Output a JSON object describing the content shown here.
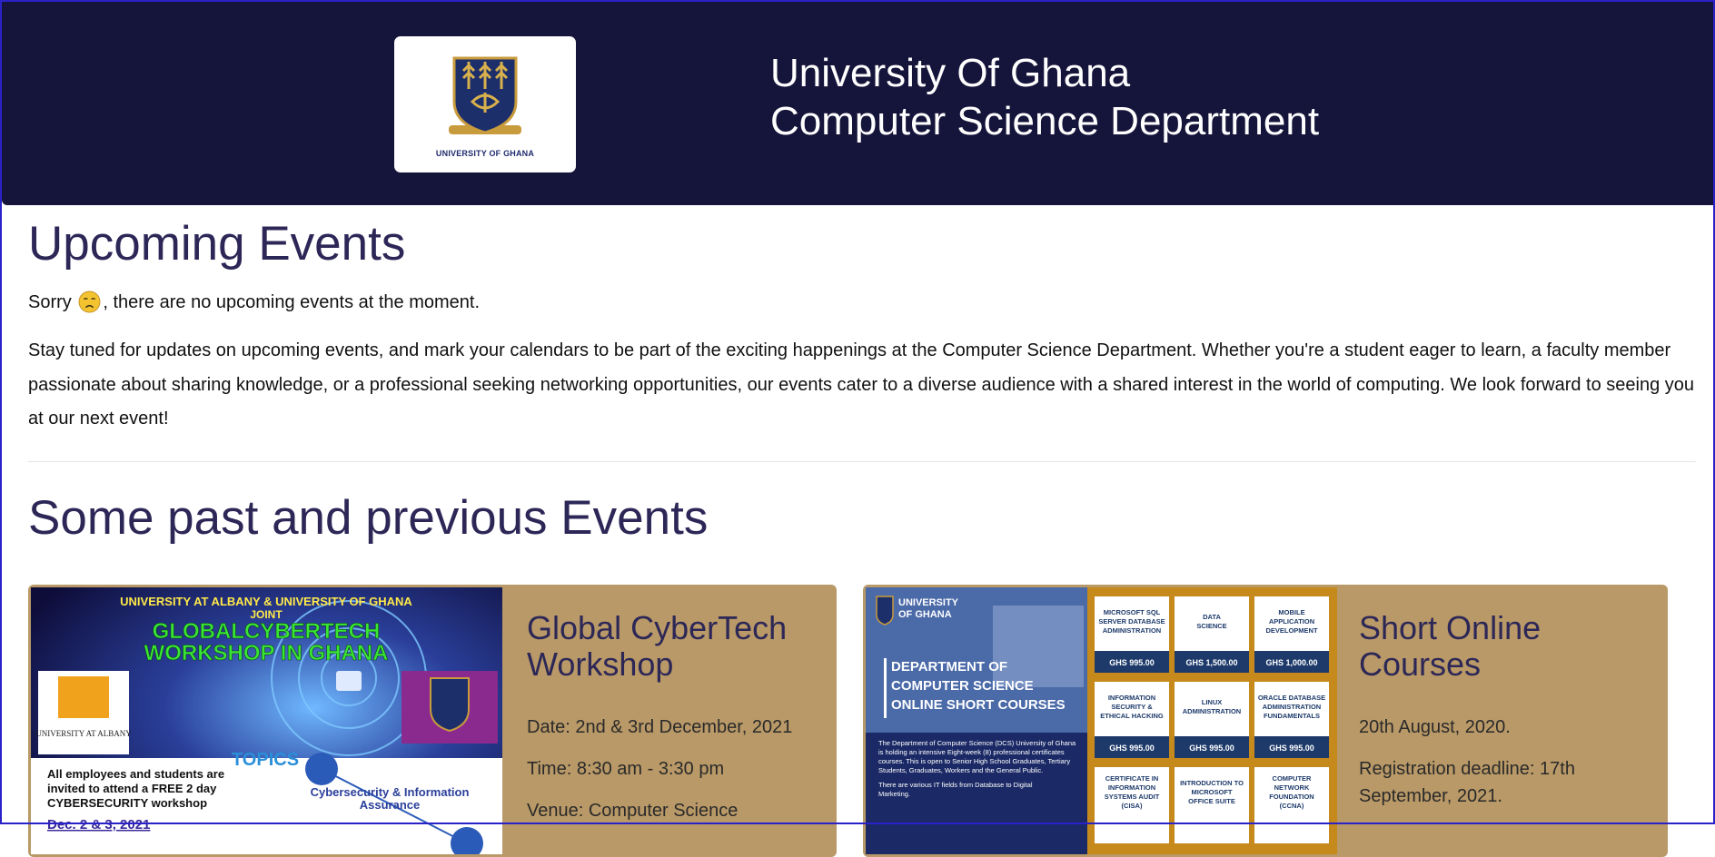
{
  "header": {
    "logo_caption": "UNIVERSITY OF GHANA",
    "title_line1": "University Of Ghana",
    "title_line2": "Computer Science Department"
  },
  "upcoming": {
    "heading": "Upcoming Events",
    "sorry_before": "Sorry",
    "sorry_after": ", there are no upcoming events at the moment.",
    "paragraph": "Stay tuned for updates on upcoming events, and mark your calendars to be part of the exciting happenings at the Computer Science Department. Whether you're a student eager to learn, a faculty member passionate about sharing knowledge, or a professional seeking networking opportunities, our events cater to a diverse audience with a shared interest in the world of computing. We look forward to seeing you at our next event!"
  },
  "past": {
    "heading": "Some past and previous Events",
    "events": [
      {
        "title_line1": "Global CyberTech",
        "title_line2": "Workshop",
        "date": "Date: 2nd & 3rd December, 2021",
        "time": "Time: 8:30 am - 3:30 pm",
        "venue": "Venue: Computer Science",
        "poster": {
          "line1": "UNIVERSITY AT ALBANY & UNIVERSITY OF GHANA",
          "line2": "JOINT",
          "line3": "GLOBALCYBERTECH",
          "line4": "WORKSHOP IN GHANA",
          "albany": "UNIVERSITY AT ALBANY",
          "topics": "TOPICS",
          "invite1": "All employees and students are",
          "invite2": "invited to attend a FREE 2 day",
          "invite3": "CYBERSECURITY workshop",
          "topic1a": "Cybersecurity & Information",
          "topic1b": "Assurance",
          "dates": "Dec. 2 & 3, 2021"
        }
      },
      {
        "title_line1": "Short Online",
        "title_line2": "Courses",
        "date": "20th August, 2020.",
        "deadline1": "Registration deadline: 17th",
        "deadline2": "September, 2021.",
        "poster": {
          "uni1": "UNIVERSITY",
          "uni2": "OF GHANA",
          "dept1": "DEPARTMENT OF",
          "dept2": "COMPUTER SCIENCE",
          "dept3": "ONLINE SHORT COURSES",
          "blurb1": "The Department of Computer Science (DCS) University of Ghana",
          "blurb2": "is holding an intensive Eight-week (8) professional certificates",
          "blurb3": "courses. This is open to Senior High School Graduates, Tertiary",
          "blurb4": "Students, Graduates, Workers and the General Public.",
          "blurb5": "There are various IT fields from Database to Digital",
          "blurb6": "Marketing.",
          "courses": [
            {
              "name": [
                "MICROSOFT SQL",
                "SERVER DATABASE",
                "ADMINISTRATION"
              ],
              "price": "GHS 995.00"
            },
            {
              "name": [
                "DATA",
                "SCIENCE"
              ],
              "price": "GHS 1,500.00"
            },
            {
              "name": [
                "MOBILE",
                "APPLICATION",
                "DEVELOPMENT"
              ],
              "price": "GHS 1,000.00"
            },
            {
              "name": [
                "INFORMATION",
                "SECURITY &",
                "ETHICAL HACKING"
              ],
              "price": "GHS 995.00"
            },
            {
              "name": [
                "LINUX",
                "ADMINISTRATION"
              ],
              "price": "GHS 995.00"
            },
            {
              "name": [
                "ORACLE DATABASE",
                "ADMINISTRATION",
                "FUNDAMENTALS"
              ],
              "price": "GHS 995.00"
            },
            {
              "name": [
                "CERTIFICATE IN",
                "INFORMATION",
                "SYSTEMS AUDIT",
                "(CISA)"
              ],
              "price": ""
            },
            {
              "name": [
                "INTRODUCTION TO",
                "MICROSOFT",
                "OFFICE SUITE"
              ],
              "price": ""
            },
            {
              "name": [
                "COMPUTER",
                "NETWORK",
                "FOUNDATION",
                "(CCNA)"
              ],
              "price": ""
            }
          ]
        }
      }
    ]
  }
}
